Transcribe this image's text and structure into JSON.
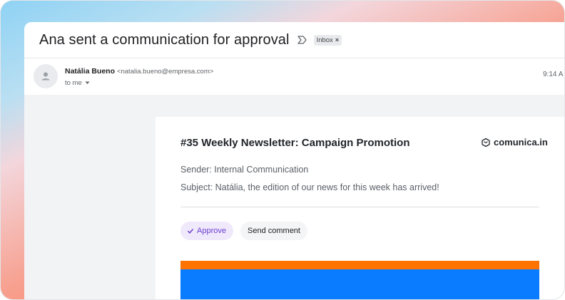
{
  "email": {
    "subject": "Ana sent a communication for approval",
    "label": "Inbox",
    "label_close": "×",
    "sender_name": "Natália Bueno",
    "sender_email": "<natalia.bueno@empresa.com>",
    "recipient": "to me",
    "time": "9:14 A"
  },
  "newsletter": {
    "title": "#35 Weekly Newsletter: Campaign Promotion",
    "brand": "comunica.in",
    "sender_line": "Sender: Internal Communication",
    "subject_line": "Subject: Natália, the edition of our news for this week has arrived!",
    "approve_label": "Approve",
    "comment_label": "Send comment"
  },
  "colors": {
    "approve_bg": "#efe9fb",
    "approve_text": "#6d3fd1",
    "banner_orange": "#ff7300",
    "banner_blue": "#0a7cff"
  }
}
